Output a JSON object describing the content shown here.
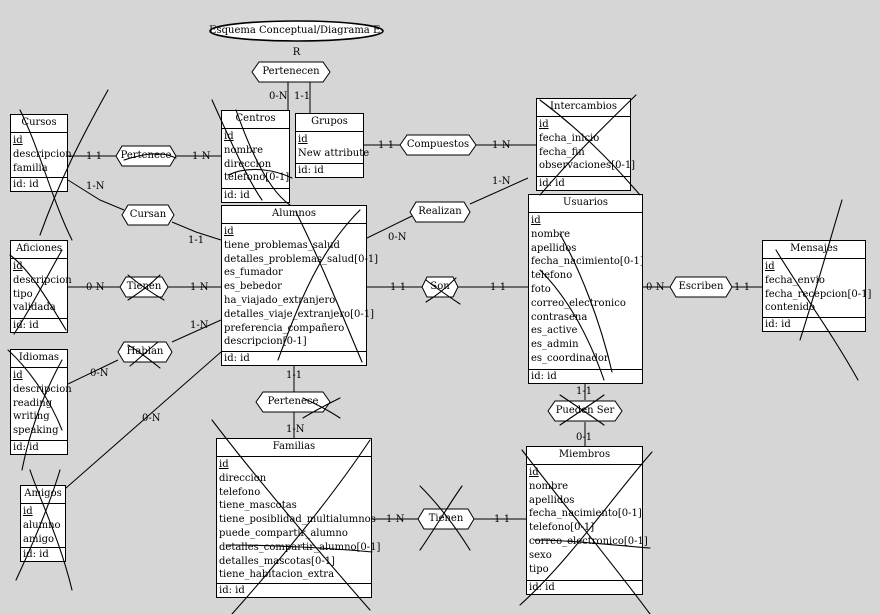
{
  "title": "Esquema Conceptual/Diagrama E-R",
  "entities": {
    "cursos": {
      "name": "Cursos",
      "attrs": [
        "id",
        "descripcion",
        "familia"
      ],
      "id_row": "id: id"
    },
    "centros": {
      "name": "Centros",
      "attrs": [
        "id",
        "nombre",
        "direccion",
        "telefono[0-1]"
      ],
      "id_row": "id: id"
    },
    "grupos": {
      "name": "Grupos",
      "attrs": [
        "id",
        "New attribute"
      ],
      "id_row": "id: id"
    },
    "intercambios": {
      "name": "Intercambios",
      "attrs": [
        "id",
        "fecha_inicio",
        "fecha_fin",
        "observaciones[0-1]"
      ],
      "id_row": "id: id"
    },
    "aficiones": {
      "name": "Aficiones",
      "attrs": [
        "id",
        "descripcion",
        "tipo",
        "validada"
      ],
      "id_row": "id: id"
    },
    "alumnos": {
      "name": "Alumnos",
      "attrs": [
        "id",
        "tiene_problemas_salud",
        "detalles_problemas_salud[0-1]",
        "es_fumador",
        "es_bebedor",
        "ha_viajado_extranjero",
        "detalles_viaje_extranjero[0-1]",
        "preferencia_compañero",
        "descripcion[0-1]"
      ],
      "id_row": "id: id"
    },
    "usuarios": {
      "name": "Usuarios",
      "attrs": [
        "id",
        "nombre",
        "apellidos",
        "fecha_nacimiento[0-1]",
        "telefono",
        "foto",
        "correo_electronico",
        "contrasena",
        "es_active",
        "es_admin",
        "es_coordinador"
      ],
      "id_row": "id: id"
    },
    "mensajes": {
      "name": "Mensajes",
      "attrs": [
        "id",
        "fecha_envio",
        "fecha_recepcion[0-1]",
        "contenido"
      ],
      "id_row": "id: id"
    },
    "idiomas": {
      "name": "Idiomas",
      "attrs": [
        "id",
        "descripcion",
        "reading",
        "writing",
        "speaking"
      ],
      "id_row": "id: id"
    },
    "amigos": {
      "name": "Amigos",
      "attrs": [
        "id",
        "alumno",
        "amigo"
      ],
      "id_row": "id: id"
    },
    "familias": {
      "name": "Familias",
      "attrs": [
        "id",
        "direccion",
        "telefono",
        "tiene_mascotas",
        "tiene_posiblidad_multialumnos",
        "puede_compartir_alumno",
        "detalles_compartir_alumno[0-1]",
        "detalles_mascotas[0-1]",
        "tiene_habitacion_extra"
      ],
      "id_row": "id: id"
    },
    "miembros": {
      "name": "Miembros",
      "attrs": [
        "id",
        "nombre",
        "apellidos",
        "fecha_nacimiento[0-1]",
        "telefono[0-1]",
        "correo_electronico[0-1]",
        "sexo",
        "tipo"
      ],
      "id_row": "id: id"
    }
  },
  "relationships": {
    "pertenecen": "Pertenecen",
    "compuestos": "Compuestos",
    "pertenece_cursos": "Pertenece",
    "cursan": "Cursan",
    "realizan": "Realizan",
    "tienen_aficiones": "Tienen",
    "son": "Son",
    "escriben": "Escriben",
    "hablan": "Hablan",
    "pertenece_familias": "Pertenece",
    "pueden_ser": "Pueden Ser",
    "tienen_miembros": "Tienen"
  },
  "cardinalities": {
    "pertenecen_centros": "0-N",
    "pertenecen_grupos": "1-1",
    "grupos_compuestos": "1-1",
    "compuestos_intercambios": "1-N",
    "cursos_pertenece": "1-1",
    "pertenece_centros": "1-N",
    "cursos_cursan": "1-N",
    "cursan_alumnos": "1-1",
    "alumnos_realizan": "0-N",
    "realizan_intercambios": "1-N",
    "aficiones_tienen": "0-N",
    "tienen_alumnos": "1-N",
    "alumnos_son": "1-1",
    "son_usuarios": "1-1",
    "usuarios_escriben": "0-N",
    "escriben_mensajes": "1-1",
    "idiomas_hablan": "0-N",
    "hablan_alumnos": "1-N",
    "amigos_alumnos": "0-N",
    "alumnos_pertenece": "1-1",
    "pertenece_familias": "1-N",
    "usuarios_puedenser": "1-1",
    "puedenser_miembros": "0-1",
    "familias_tienen": "1-N",
    "tienen_miembros": "1-1"
  }
}
